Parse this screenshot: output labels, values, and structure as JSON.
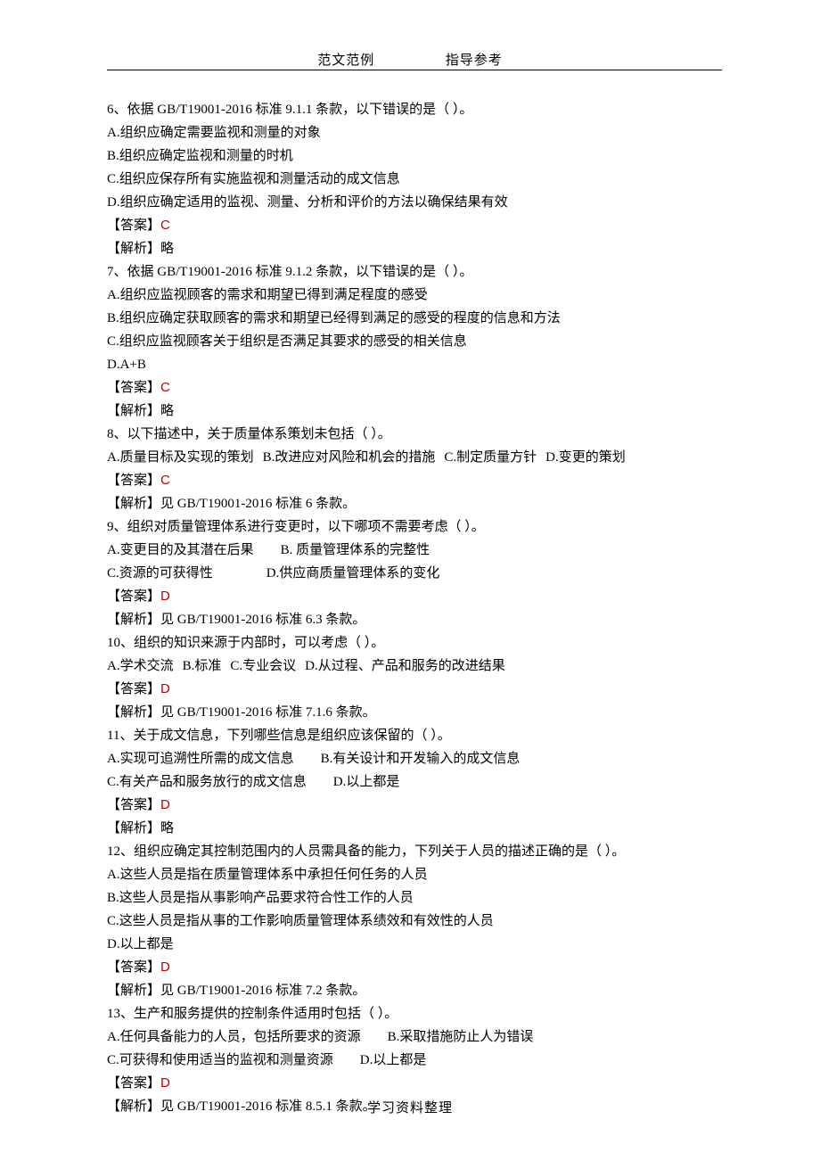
{
  "header": {
    "left": "范文范例",
    "right": "指导参考"
  },
  "footer": "学习资料整理",
  "labels": {
    "answer": "【答案】",
    "explain": "【解析】"
  },
  "questions": [
    {
      "num": "6",
      "stem": "依据 GB/T19001-2016 标准 9.1.1 条款，以下错误的是（ ）。",
      "options": [
        "A.组织应确定需要监视和测量的对象",
        "B.组织应确定监视和测量的时机",
        "C.组织应保存所有实施监视和测量活动的成文信息",
        "D.组织应确定适用的监视、测量、分析和评价的方法以确保结果有效"
      ],
      "options_layout": "block",
      "answer": "C",
      "explain": "略"
    },
    {
      "num": "7",
      "stem": "依据 GB/T19001-2016 标准 9.1.2 条款，以下错误的是（ ）。",
      "options": [
        "A.组织应监视顾客的需求和期望已得到满足程度的感受",
        "B.组织应确定获取顾客的需求和期望已经得到满足的感受的程度的信息和方法",
        "C.组织应监视顾客关于组织是否满足其要求的感受的相关信息",
        "D.A+B"
      ],
      "options_layout": "block",
      "answer": "C",
      "explain": "略"
    },
    {
      "num": "8",
      "stem": "以下描述中，关于质量体系策划未包括（ ）。",
      "options": [
        "A.质量目标及实现的策划",
        "B.改进应对风险和机会的措施",
        "C.制定质量方针",
        "D.变更的策划"
      ],
      "options_layout": "inline",
      "answer": "C",
      "explain": "见 GB/T19001-2016 标准 6 条款。"
    },
    {
      "num": "9",
      "stem": "组织对质量管理体系进行变更时，以下哪项不需要考虑（ ）。",
      "options": [
        "A.变更目的及其潜在后果",
        "B. 质量管理体系的完整性",
        "C.资源的可获得性",
        "D.供应商质量管理体系的变化"
      ],
      "options_layout": "two-col",
      "answer": "D",
      "explain": "见 GB/T19001-2016 标准 6.3 条款。"
    },
    {
      "num": "10",
      "stem": "组织的知识来源于内部时，可以考虑（ ）。",
      "options": [
        "A.学术交流",
        "B.标准",
        "C.专业会议",
        "D.从过程、产品和服务的改进结果"
      ],
      "options_layout": "inline",
      "answer": "D",
      "explain": "见 GB/T19001-2016 标准 7.1.6 条款。"
    },
    {
      "num": "11",
      "stem": "关于成文信息，下列哪些信息是组织应该保留的（ ）。",
      "options": [
        "A.实现可追溯性所需的成文信息",
        "B.有关设计和开发输入的成文信息",
        "C.有关产品和服务放行的成文信息",
        "D.以上都是"
      ],
      "options_layout": "two-col",
      "answer": "D",
      "explain": "略"
    },
    {
      "num": "12",
      "stem": "组织应确定其控制范围内的人员需具备的能力，下列关于人员的描述正确的是（ ）。",
      "options": [
        "A.这些人员是指在质量管理体系中承担任何任务的人员",
        "B.这些人员是指从事影响产品要求符合性工作的人员",
        "C.这些人员是指从事的工作影响质量管理体系绩效和有效性的人员",
        "D.以上都是"
      ],
      "options_layout": "block",
      "answer": "D",
      "explain": "见 GB/T19001-2016 标准 7.2 条款。"
    },
    {
      "num": "13",
      "stem": "生产和服务提供的控制条件适用时包括（ ）。",
      "options": [
        "A.任何具备能力的人员，包括所要求的资源",
        "B.采取措施防止人为错误",
        "C.可获得和使用适当的监视和测量资源",
        "D.以上都是"
      ],
      "options_layout": "two-col",
      "answer": "D",
      "explain": "见 GB/T19001-2016 标准 8.5.1 条款。"
    }
  ]
}
